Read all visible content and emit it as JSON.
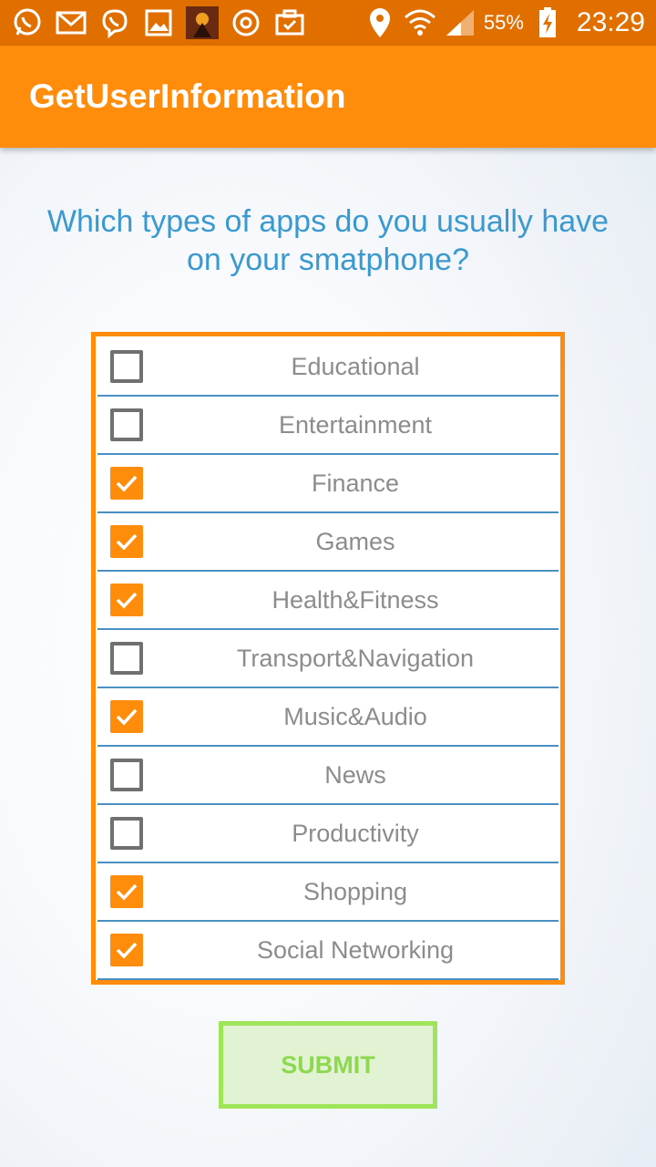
{
  "status_bar": {
    "battery_percent": "55%",
    "time": "23:29",
    "icons": [
      "whatsapp-icon",
      "gmail-icon",
      "viber-icon",
      "gallery-icon",
      "game-app-icon",
      "sync-icon",
      "briefcase-check-icon",
      "location-icon",
      "wifi-icon",
      "signal-icon",
      "battery-charging-icon"
    ]
  },
  "app_bar": {
    "title": "GetUserInformation"
  },
  "question": "Which types of apps do you usually have on your smatphone?",
  "options": [
    {
      "label": "Educational",
      "checked": false
    },
    {
      "label": "Entertainment",
      "checked": false
    },
    {
      "label": "Finance",
      "checked": true
    },
    {
      "label": "Games",
      "checked": true
    },
    {
      "label": "Health&Fitness",
      "checked": true
    },
    {
      "label": "Transport&Navigation",
      "checked": false
    },
    {
      "label": "Music&Audio",
      "checked": true
    },
    {
      "label": "News",
      "checked": false
    },
    {
      "label": "Productivity",
      "checked": false
    },
    {
      "label": "Shopping",
      "checked": true
    },
    {
      "label": "Social Networking",
      "checked": true
    }
  ],
  "submit_label": "SUBMIT",
  "colors": {
    "status_bar": "#e06f00",
    "accent": "#ff8c0a",
    "question_text": "#3a9ad0",
    "divider": "#4a90c2",
    "submit_border": "#9ee55a",
    "submit_fill": "#e2f3d4"
  }
}
